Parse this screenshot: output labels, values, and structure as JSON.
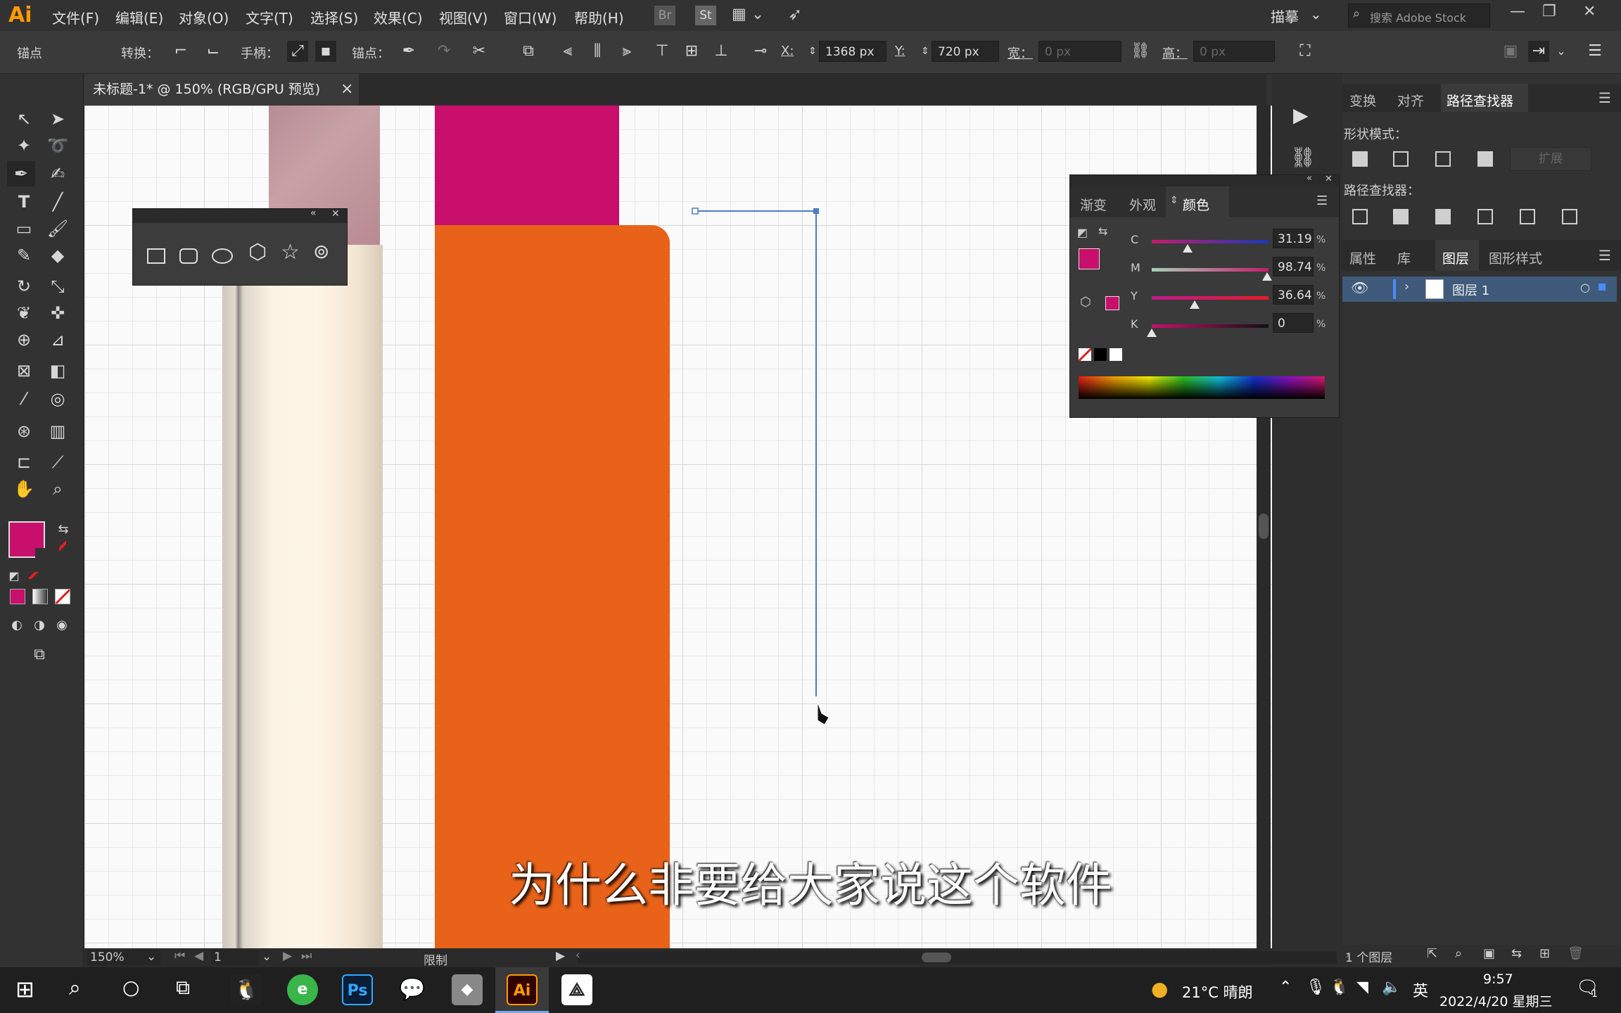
{
  "app": {
    "logo": "Ai"
  },
  "menu": [
    "文件(F)",
    "编辑(E)",
    "对象(O)",
    "文字(T)",
    "选择(S)",
    "效果(C)",
    "视图(V)",
    "窗口(W)",
    "帮助(H)"
  ],
  "menubar_right": {
    "br": "Br",
    "st": "St",
    "workspace": "描摹",
    "search_placeholder": "搜索 Adobe Stock"
  },
  "control": {
    "anchor_label": "锚点",
    "convert_label": "转换：",
    "handle_label": "手柄：",
    "anchors_label": "锚点：",
    "x_label": "X:",
    "x_value": "1368 px",
    "y_label": "Y:",
    "y_value": "720 px",
    "w_label": "宽：",
    "w_value": "0 px",
    "h_label": "高：",
    "h_value": "0 px"
  },
  "document_tab": {
    "title": "未标题-1* @ 150% (RGB/GPU 预览)",
    "close": "×"
  },
  "color_panel": {
    "tabs": [
      "渐变",
      "外观",
      "颜色"
    ],
    "active_tab": "颜色",
    "channels": [
      {
        "label": "C",
        "value": "31.19",
        "level": 0.31
      },
      {
        "label": "M",
        "value": "98.74",
        "level": 0.99
      },
      {
        "label": "Y",
        "value": "36.64",
        "level": 0.37
      },
      {
        "label": "K",
        "value": "0",
        "level": 0
      }
    ],
    "percent": "%",
    "fill_color": "#c80f6c"
  },
  "right_panel": {
    "top_tabs": [
      "变换",
      "对齐",
      "路径查找器"
    ],
    "active_top_tab": "路径查找器",
    "shape_modes_label": "形状模式：",
    "expand_label": "扩展",
    "pathfinder_label": "路径查找器：",
    "bottom_tabs": [
      "属性",
      "库",
      "图层",
      "图形样式"
    ],
    "active_bottom_tab": "图层",
    "layer_name": "图层 1",
    "layers_count": "1 个图层"
  },
  "status": {
    "zoom": "150%",
    "artboard": "1",
    "mode": "限制"
  },
  "subtitle": "为什么非要给大家说这个软件",
  "taskbar": {
    "weather": "21°C 晴朗",
    "ime": "英",
    "time": "9:57",
    "date": "2022/4/20 星期三",
    "notify": "1",
    "ai": "Ai",
    "ps": "Ps"
  },
  "colors": {
    "magenta": "#c80f6c",
    "orange": "#e8621a",
    "accent": "#ff9a00"
  }
}
